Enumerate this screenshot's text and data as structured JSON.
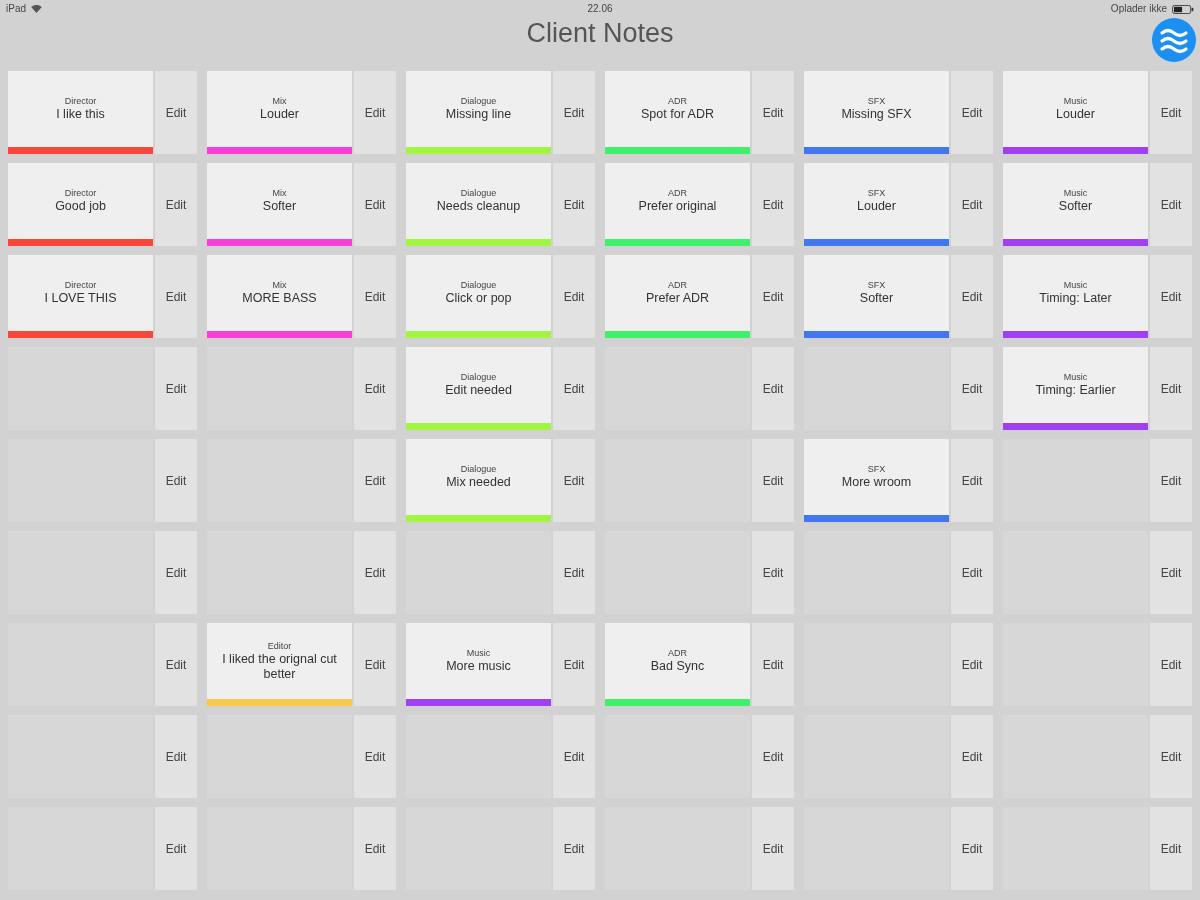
{
  "status_bar": {
    "device": "iPad",
    "time": "22.06",
    "charging_status": "Oplader ikke"
  },
  "header": {
    "title": "Client Notes"
  },
  "grid": {
    "rows": [
      {
        "cells": [
          {
            "kind": "note",
            "category": "Director",
            "text": "I like this",
            "color": "#f5483b",
            "edit_label": "Edit"
          },
          {
            "kind": "note",
            "category": "Mix",
            "text": "Louder",
            "color": "#f53fd5",
            "edit_label": "Edit"
          },
          {
            "kind": "note",
            "category": "Dialogue",
            "text": "Missing line",
            "color": "#a2f542",
            "edit_label": "Edit"
          },
          {
            "kind": "note",
            "category": "ADR",
            "text": "Spot for ADR",
            "color": "#40ef6a",
            "edit_label": "Edit"
          },
          {
            "kind": "note",
            "category": "SFX",
            "text": "Missing SFX",
            "color": "#4477ee",
            "edit_label": "Edit"
          },
          {
            "kind": "note",
            "category": "Music",
            "text": "Louder",
            "color": "#a040f0",
            "edit_label": "Edit"
          }
        ]
      },
      {
        "cells": [
          {
            "kind": "note",
            "category": "Director",
            "text": "Good job",
            "color": "#f5483b",
            "edit_label": "Edit"
          },
          {
            "kind": "note",
            "category": "Mix",
            "text": "Softer",
            "color": "#f53fd5",
            "edit_label": "Edit"
          },
          {
            "kind": "note",
            "category": "Dialogue",
            "text": "Needs cleanup",
            "color": "#a2f542",
            "edit_label": "Edit"
          },
          {
            "kind": "note",
            "category": "ADR",
            "text": "Prefer original",
            "color": "#40ef6a",
            "edit_label": "Edit"
          },
          {
            "kind": "note",
            "category": "SFX",
            "text": "Louder",
            "color": "#4477ee",
            "edit_label": "Edit"
          },
          {
            "kind": "note",
            "category": "Music",
            "text": "Softer",
            "color": "#a040f0",
            "edit_label": "Edit"
          }
        ]
      },
      {
        "cells": [
          {
            "kind": "note",
            "category": "Director",
            "text": "I LOVE THIS",
            "color": "#f5483b",
            "edit_label": "Edit"
          },
          {
            "kind": "note",
            "category": "Mix",
            "text": "MORE BASS",
            "color": "#f53fd5",
            "edit_label": "Edit"
          },
          {
            "kind": "note",
            "category": "Dialogue",
            "text": "Click or pop",
            "color": "#a2f542",
            "edit_label": "Edit"
          },
          {
            "kind": "note",
            "category": "ADR",
            "text": "Prefer ADR",
            "color": "#40ef6a",
            "edit_label": "Edit"
          },
          {
            "kind": "note",
            "category": "SFX",
            "text": "Softer",
            "color": "#4477ee",
            "edit_label": "Edit"
          },
          {
            "kind": "note",
            "category": "Music",
            "text": "Timing: Later",
            "color": "#a040f0",
            "edit_label": "Edit"
          }
        ]
      },
      {
        "cells": [
          {
            "kind": "empty",
            "edit_label": "Edit"
          },
          {
            "kind": "empty",
            "edit_label": "Edit"
          },
          {
            "kind": "note",
            "category": "Dialogue",
            "text": "Edit needed",
            "color": "#a2f542",
            "edit_label": "Edit"
          },
          {
            "kind": "empty",
            "edit_label": "Edit"
          },
          {
            "kind": "empty",
            "edit_label": "Edit"
          },
          {
            "kind": "note",
            "category": "Music",
            "text": "Timing: Earlier",
            "color": "#a040f0",
            "edit_label": "Edit"
          }
        ]
      },
      {
        "cells": [
          {
            "kind": "empty",
            "edit_label": "Edit"
          },
          {
            "kind": "empty",
            "edit_label": "Edit"
          },
          {
            "kind": "note",
            "category": "Dialogue",
            "text": "Mix needed",
            "color": "#a2f542",
            "edit_label": "Edit"
          },
          {
            "kind": "empty",
            "edit_label": "Edit"
          },
          {
            "kind": "note",
            "category": "SFX",
            "text": "More wroom",
            "color": "#4477ee",
            "edit_label": "Edit"
          },
          {
            "kind": "empty",
            "edit_label": "Edit"
          }
        ]
      },
      {
        "cells": [
          {
            "kind": "empty",
            "edit_label": "Edit"
          },
          {
            "kind": "empty",
            "edit_label": "Edit"
          },
          {
            "kind": "empty",
            "edit_label": "Edit"
          },
          {
            "kind": "empty",
            "edit_label": "Edit"
          },
          {
            "kind": "empty",
            "edit_label": "Edit"
          },
          {
            "kind": "empty",
            "edit_label": "Edit"
          }
        ]
      },
      {
        "cells": [
          {
            "kind": "empty",
            "edit_label": "Edit"
          },
          {
            "kind": "note",
            "category": "Editor",
            "text": "I liked the orignal cut better",
            "color": "#f7c94e",
            "edit_label": "Edit"
          },
          {
            "kind": "note",
            "category": "Music",
            "text": "More music",
            "color": "#a040f0",
            "edit_label": "Edit"
          },
          {
            "kind": "note",
            "category": "ADR",
            "text": "Bad Sync",
            "color": "#40ef6a",
            "edit_label": "Edit"
          },
          {
            "kind": "empty",
            "edit_label": "Edit"
          },
          {
            "kind": "empty",
            "edit_label": "Edit"
          }
        ]
      },
      {
        "cells": [
          {
            "kind": "empty",
            "edit_label": "Edit"
          },
          {
            "kind": "empty",
            "edit_label": "Edit"
          },
          {
            "kind": "empty",
            "edit_label": "Edit"
          },
          {
            "kind": "empty",
            "edit_label": "Edit"
          },
          {
            "kind": "empty",
            "edit_label": "Edit"
          },
          {
            "kind": "empty",
            "edit_label": "Edit"
          }
        ]
      },
      {
        "cells": [
          {
            "kind": "empty",
            "edit_label": "Edit"
          },
          {
            "kind": "empty",
            "edit_label": "Edit"
          },
          {
            "kind": "empty",
            "edit_label": "Edit"
          },
          {
            "kind": "empty",
            "edit_label": "Edit"
          },
          {
            "kind": "empty",
            "edit_label": "Edit"
          },
          {
            "kind": "empty",
            "edit_label": "Edit"
          }
        ]
      }
    ]
  }
}
